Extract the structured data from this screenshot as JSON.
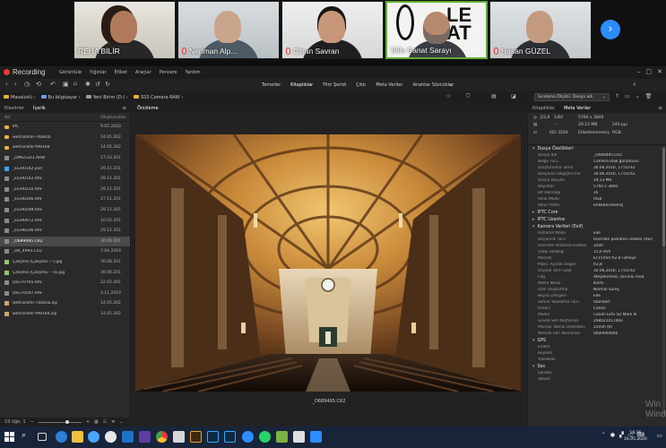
{
  "conference": {
    "participants": [
      {
        "name": "REHA BİLİR",
        "muted": false
      },
      {
        "name": "Neriman Alp...",
        "muted": true
      },
      {
        "name": "Cihan Savran",
        "muted": true
      },
      {
        "name": "Sille Sanat Sarayı",
        "muted": false,
        "active": true
      },
      {
        "name": "Hasan GÜZEL",
        "muted": true
      }
    ],
    "next_icon": "chevron-right-icon"
  },
  "app": {
    "title": "Recording",
    "menu": [
      "Dosya",
      "Görüntüle",
      "Yığınlar",
      "Etiket",
      "Araçlar",
      "Pencere",
      "Yardım"
    ],
    "workspaces": [
      "Temeller",
      "Kitaplıklar",
      "Film Şeridi",
      "Çıktı",
      "Meta Veriler",
      "Anahtar Sözcükler"
    ],
    "active_workspace": "Kitaplıklar",
    "breadcrumbs": [
      "Masaüstü",
      "Bu bilgisayar",
      "Yeni Birim (D:)",
      "SSS Camera RAW"
    ],
    "sort_label": "Sıralama Ölçütü: Dosya adı"
  },
  "left_panel": {
    "tabs": [
      "Klasörler",
      "İçerik"
    ],
    "active_tab": "İçerik",
    "columns": [
      "Ad",
      "Oluşturulma"
    ],
    "files": [
      {
        "name": "IPC",
        "date": "9.05.2020",
        "type": "folder"
      },
      {
        "name": "wetransfer-7da6cb",
        "date": "14.05.202",
        "type": "folder"
      },
      {
        "name": "wetransfer-f9919d",
        "date": "14.05.202",
        "type": "folder"
      },
      {
        "name": "_DMG5323.ARW",
        "date": "17.03.201",
        "type": "raw"
      },
      {
        "name": "_EGH0142.psd",
        "date": "29.11.201",
        "type": "psd"
      },
      {
        "name": "_EGH0142.RAF",
        "date": "29.11.201",
        "type": "raw"
      },
      {
        "name": "_EGH0210.RAF",
        "date": "29.11.201",
        "type": "raw"
      },
      {
        "name": "_EGH0266.RAF",
        "date": "27.11.201",
        "type": "raw"
      },
      {
        "name": "_EGH0509.RAF",
        "date": "29.11.201",
        "type": "raw"
      },
      {
        "name": "_EGH0972.RAF",
        "date": "10.02.201",
        "type": "raw"
      },
      {
        "name": "_EGH8336.RAF",
        "date": "29.11.201",
        "type": "raw"
      },
      {
        "name": "_O689495.CR2",
        "date": "30.06.201",
        "type": "raw",
        "selected": true
      },
      {
        "name": "_UR_4993.CR2",
        "date": "7.04.2018",
        "type": "raw"
      },
      {
        "name": "Çalışma (Çalışma ---).jpg",
        "date": "30.06.201",
        "type": "jpg"
      },
      {
        "name": "Çalışma (Çalışma ---)a.jpg",
        "date": "30.06.201",
        "type": "jpg"
      },
      {
        "name": "DSCF0765.RAF",
        "date": "22.02.201",
        "type": "raw"
      },
      {
        "name": "DSCF0597.RAF",
        "date": "3.11.2019",
        "type": "raw"
      },
      {
        "name": "wetransfer-7da6cb.zip",
        "date": "14.05.202",
        "type": "zip"
      },
      {
        "name": "wetransfer-f9919d.zip",
        "date": "14.05.202",
        "type": "zip"
      }
    ],
    "footer_count": "19 öğe, 1"
  },
  "preview": {
    "tab": "Önizleme",
    "caption": "_O689495.CR2"
  },
  "right_panel": {
    "tabs": [
      "Kitaplıklar",
      "Meta Veriler"
    ],
    "active_tab": "Meta Veriler",
    "summary": {
      "aperture": "ƒ/2,8",
      "shutter": "1/60",
      "iso": "ISO 3200",
      "ev": "--",
      "dimensions": "5760 x 3840",
      "filesize": "29.13 MB",
      "dpi": "240 ppi",
      "tag": "Etiketlenmemiş",
      "colorspace": "RGB"
    },
    "sections": [
      {
        "title": "Dosya Özellikleri",
        "collapsed": false,
        "rows": [
          [
            "Dosya adı",
            "_O689495.CR2"
          ],
          [
            "Belge Türü",
            "Camera Raw görüntüsü"
          ],
          [
            "Oluşturulma Tarihi",
            "30.06.2016, 17:03:42"
          ],
          [
            "Dosyanın Değiştirilme",
            "30.06.2016, 17:03:42"
          ],
          [
            "Dosya Boyutu",
            "29.13 MB"
          ],
          [
            "Boyutlar",
            "5760 x 3840"
          ],
          [
            "Bit Derinliği",
            "16"
          ],
          [
            "Renk Modu",
            "RGB"
          ],
          [
            "Renk Profili",
            "Etiketlenmemiş"
          ]
        ]
      },
      {
        "title": "IPTC Core",
        "collapsed": true,
        "rows": []
      },
      {
        "title": "IPTC Uzantısı",
        "collapsed": true,
        "rows": []
      },
      {
        "title": "Kamera Verileri (Exif)",
        "collapsed": false,
        "rows": [
          [
            "Pozlama Modu",
            "Elle"
          ],
          [
            "Duyarlılık Türü",
            "Önerilen pozlama indeksi (REI)"
          ],
          [
            "Önerilen Pozlama İndeksi",
            "3200"
          ],
          [
            "Odak Uzaklığı",
            "15,0 mm"
          ],
          [
            "Mercek",
            "EF15mm f/2.8 Fisheye"
          ],
          [
            "Maks. Açıklık Değeri",
            "f/2,8"
          ],
          [
            "Orijinal Tarih Saat",
            "30.06.2016, 17:03:42"
          ],
          [
            "Flaş",
            "Ateşlenmedi, zorunlu mod"
          ],
          [
            "Metre Modu",
            "Kısmi"
          ],
          [
            "Özel Oluşturma",
            "Normal Süreç"
          ],
          [
            "Beyaz Dengesi",
            "Elle"
          ],
          [
            "Sahne Yakalama Türü",
            "Standart"
          ],
          [
            "Üretici",
            "Canon"
          ],
          [
            "Model",
            "Canon EOS 5D Mark III"
          ],
          [
            "Gövde Seri Numarası",
            "268021011060"
          ],
          [
            "Mercek Teknik Özellikleri",
            "15mm f/0"
          ],
          [
            "Mercek Seri Numarası",
            "0000000000"
          ]
        ]
      },
      {
        "title": "GPS",
        "collapsed": false,
        "rows": [
          [
            "Enlem",
            ""
          ],
          [
            "Boylam",
            ""
          ],
          [
            "Yükseklik",
            ""
          ]
        ]
      },
      {
        "title": "Ses",
        "collapsed": false,
        "rows": [
          [
            "Sanatçı",
            ""
          ],
          [
            "Albüm",
            ""
          ]
        ]
      }
    ]
  },
  "watermark": [
    "Win",
    "Wind"
  ],
  "taskbar": {
    "time": "16:36",
    "date": "16.05.2020",
    "apps": [
      "windows-icon",
      "search-icon",
      "task-view-icon",
      "edge-icon",
      "explorer-icon",
      "chrome-icon",
      "bridge-icon",
      "photoshop-icon",
      "zoom-icon",
      "whatsapp-icon"
    ]
  },
  "colors": {
    "accent_active_speaker": "#5fae35",
    "record": "#e23b2e",
    "zoom_blue": "#2d8cff",
    "folder": "#e8b23a",
    "taskbar": "#18243a"
  }
}
